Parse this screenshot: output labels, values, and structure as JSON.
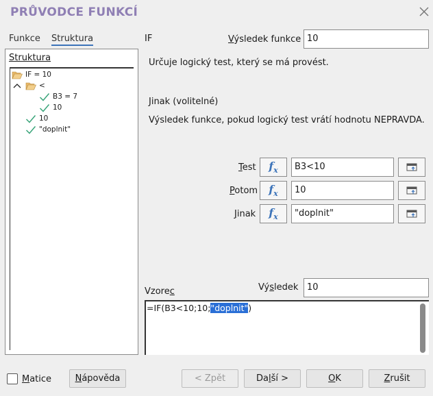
{
  "window": {
    "title": "PRŮVODCE FUNKCÍ"
  },
  "tabs": [
    {
      "label": "Funkce",
      "active": false
    },
    {
      "label": "Struktura",
      "active": true
    }
  ],
  "structure": {
    "title": "Struktura",
    "tree": [
      {
        "label": "IF = 10",
        "icon": "folder-open-icon",
        "level": 0
      },
      {
        "label": "<",
        "icon": "folder-open-icon",
        "level": 1,
        "expanded": true
      },
      {
        "label": "B3 = 7",
        "icon": "checkmark-icon",
        "level": 2
      },
      {
        "label": "10",
        "icon": "checkmark-icon",
        "level": 2
      },
      {
        "label": "10",
        "icon": "checkmark-icon",
        "level": 1
      },
      {
        "label": "\"doplnit\"",
        "icon": "checkmark-icon",
        "level": 1
      }
    ]
  },
  "function": {
    "name": "IF",
    "result_label": "Výsledek funkce",
    "result_value": "10",
    "description": "Určuje logický test, který se má provést.",
    "arg_title": "Jinak (volitelné)",
    "arg_description": "Výsledek funkce, pokud logický test vrátí hodnotu NEPRAVDA."
  },
  "arguments": [
    {
      "label": "Test",
      "value": "B3<10"
    },
    {
      "label": "Potom",
      "value": "10"
    },
    {
      "label": "Jinak",
      "value": "\"doplnit\""
    }
  ],
  "formula": {
    "label": "Vzorec",
    "result_label": "Výsledek",
    "result_value": "10",
    "text_before": "=IF(B3<10;10;",
    "text_selected": "\"doplnit\"",
    "text_after": ")"
  },
  "footer": {
    "matrix_label": "Matice",
    "help_label": "Nápověda",
    "back_label": "< Zpět",
    "next_label": "Další >",
    "ok_label": "OK",
    "cancel_label": "Zrušit"
  },
  "colors": {
    "title": "#8f7fb4",
    "accent": "#3b73b9",
    "check": "#3aa57a",
    "folder": "#e8b96a",
    "selection": "#2a6fd6"
  }
}
